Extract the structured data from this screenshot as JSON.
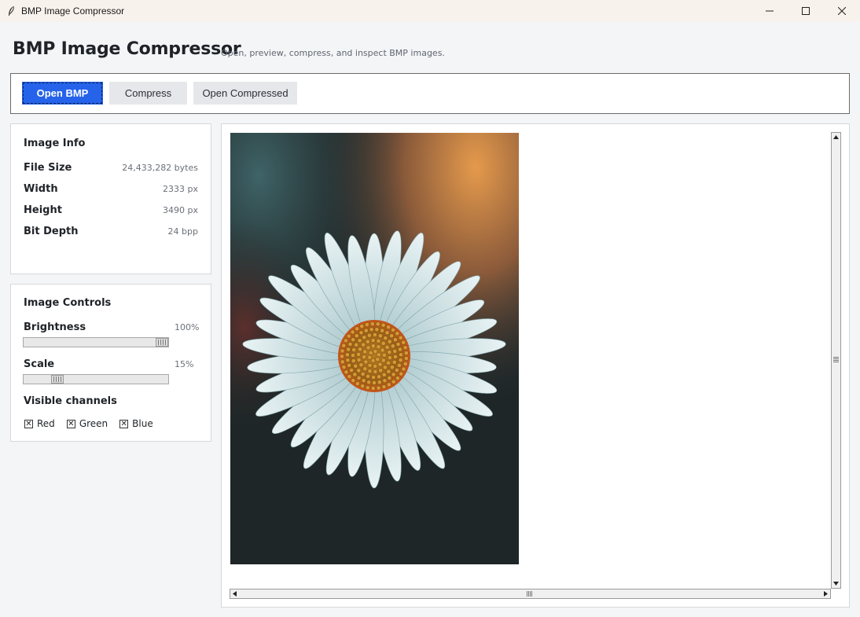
{
  "window": {
    "title": "BMP Image Compressor",
    "icon": "feather-icon",
    "controls": [
      "minimize-icon",
      "maximize-icon",
      "close-icon"
    ]
  },
  "header": {
    "title": "BMP Image Compressor",
    "subtitle": "Open, preview, compress, and inspect BMP images."
  },
  "toolbar": {
    "open_label": "Open BMP",
    "compress_label": "Compress",
    "open_compressed_label": "Open Compressed"
  },
  "info": {
    "title": "Image Info",
    "rows": [
      {
        "label": "File Size",
        "value": "24,433,282 bytes"
      },
      {
        "label": "Width",
        "value": "2333 px"
      },
      {
        "label": "Height",
        "value": "3490 px"
      },
      {
        "label": "Bit Depth",
        "value": "24 bpp"
      }
    ]
  },
  "controls": {
    "title": "Image Controls",
    "brightness": {
      "label": "Brightness",
      "value": "100%",
      "level": 1.0
    },
    "scale": {
      "label": "Scale",
      "value": "15%",
      "level": 0.15
    },
    "channels_label": "Visible channels",
    "channels": [
      {
        "label": "Red",
        "checked": true
      },
      {
        "label": "Green",
        "checked": true
      },
      {
        "label": "Blue",
        "checked": true
      }
    ]
  },
  "preview": {
    "image_subject": "white daisy flower on dark blurred background"
  },
  "colors": {
    "accent": "#2563eb",
    "background": "#f4f5f7",
    "panel": "#ffffff"
  }
}
